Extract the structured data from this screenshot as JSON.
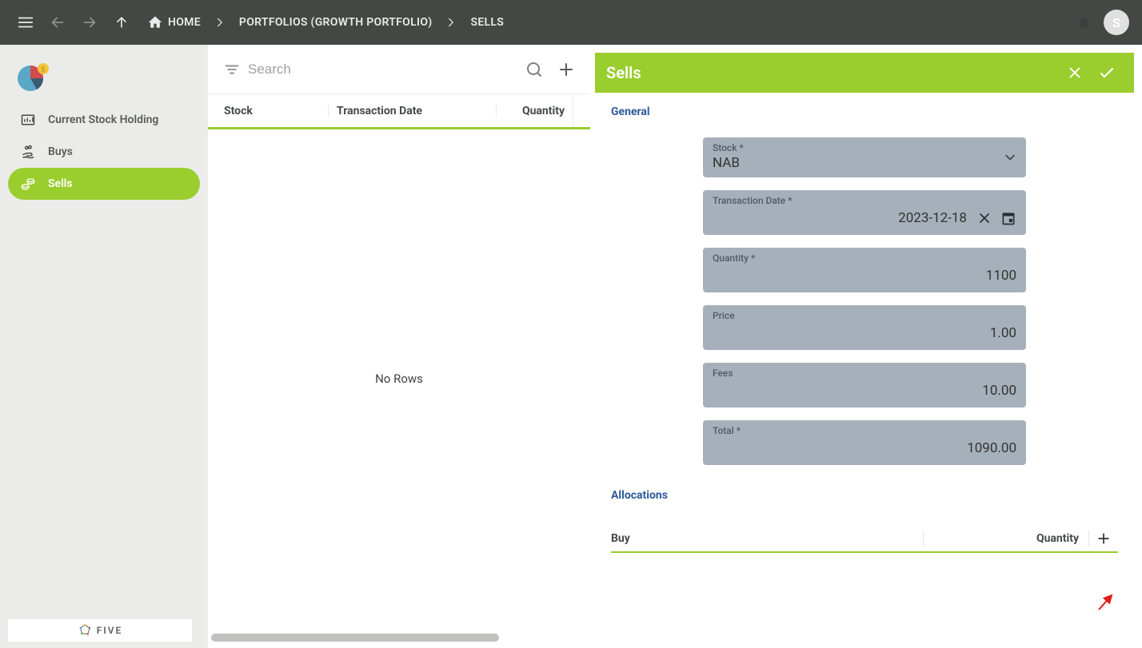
{
  "topbar": {
    "home_label": "HOME",
    "crumbs": [
      "PORTFOLIOS (GROWTH PORTFOLIO)",
      "SELLS"
    ],
    "avatar_initial": "S"
  },
  "sidebar": {
    "items": [
      {
        "label": "Current Stock Holding"
      },
      {
        "label": "Buys"
      },
      {
        "label": "Sells"
      }
    ],
    "brand": "FIVE"
  },
  "list": {
    "search_placeholder": "Search",
    "columns": {
      "stock": "Stock",
      "tdate": "Transaction Date",
      "qty": "Quantity"
    },
    "empty": "No Rows"
  },
  "form": {
    "title": "Sells",
    "section_general": "General",
    "stock_label": "Stock *",
    "stock_value": "NAB",
    "tdate_label": "Transaction Date *",
    "tdate_value": "2023-12-18",
    "qty_label": "Quantity *",
    "qty_value": "1100",
    "price_label": "Price",
    "price_value": "1.00",
    "fees_label": "Fees",
    "fees_value": "10.00",
    "total_label": "Total *",
    "total_value": "1090.00",
    "section_alloc": "Allocations",
    "alloc_columns": {
      "buy": "Buy",
      "qty": "Quantity"
    }
  }
}
